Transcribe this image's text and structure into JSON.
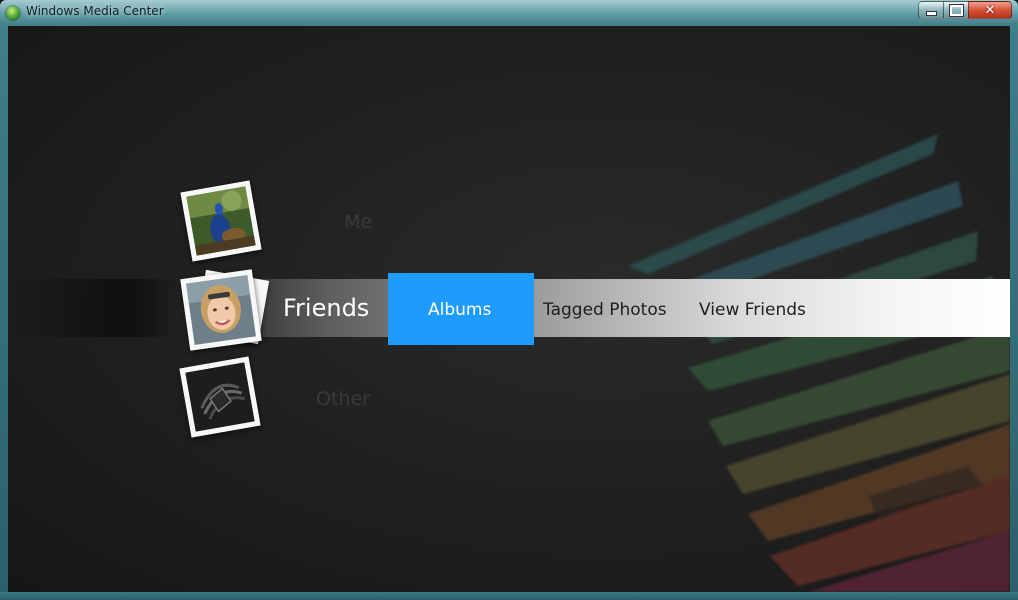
{
  "window": {
    "title": "Windows Media Center",
    "controls": {
      "minimize_icon": "minimize-icon",
      "maximize_icon": "maximize-icon",
      "close_icon": "close-icon"
    }
  },
  "menu": {
    "categories": {
      "above": "Me",
      "current": "Friends",
      "below": "Other"
    },
    "items": [
      {
        "label": "Albums",
        "focused": true
      },
      {
        "label": "Tagged Photos",
        "focused": false
      },
      {
        "label": "View Friends",
        "focused": false
      }
    ],
    "thumbnails": {
      "me": "peacock-photo",
      "friends": "portrait-photo",
      "other": "abstract-photo"
    }
  },
  "colors": {
    "focus": "#1e9bff",
    "background": "#1f1f1f",
    "label_dim": "#3a3a3a",
    "label_dark": "#1e1e1e",
    "glass": "#3f7f88",
    "close_button": "#d4533a"
  }
}
